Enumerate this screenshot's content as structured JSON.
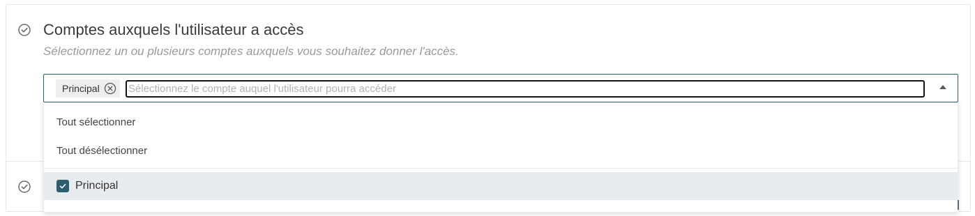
{
  "section": {
    "title": "Comptes auxquels l'utilisateur a accès",
    "subtitle": "Sélectionnez un ou plusieurs comptes auxquels vous souhaitez donner l'accès."
  },
  "select": {
    "selected_chips": [
      "Principal"
    ],
    "placeholder": "Sélectionnez le compte auquel l'utilisateur pourra accéder",
    "value": ""
  },
  "dropdown": {
    "select_all_label": "Tout sélectionner",
    "deselect_all_label": "Tout désélectionner",
    "options": [
      {
        "label": "Principal",
        "checked": true
      }
    ]
  },
  "icons": {
    "section_status": "check-circle-icon",
    "chip_remove": "close-circle-icon",
    "caret": "caret-up-icon",
    "checkbox": "checkmark-icon"
  },
  "colors": {
    "accent": "#2c5f6e",
    "option_highlight": "#e9ecee",
    "placeholder": "#b3b3b3"
  }
}
